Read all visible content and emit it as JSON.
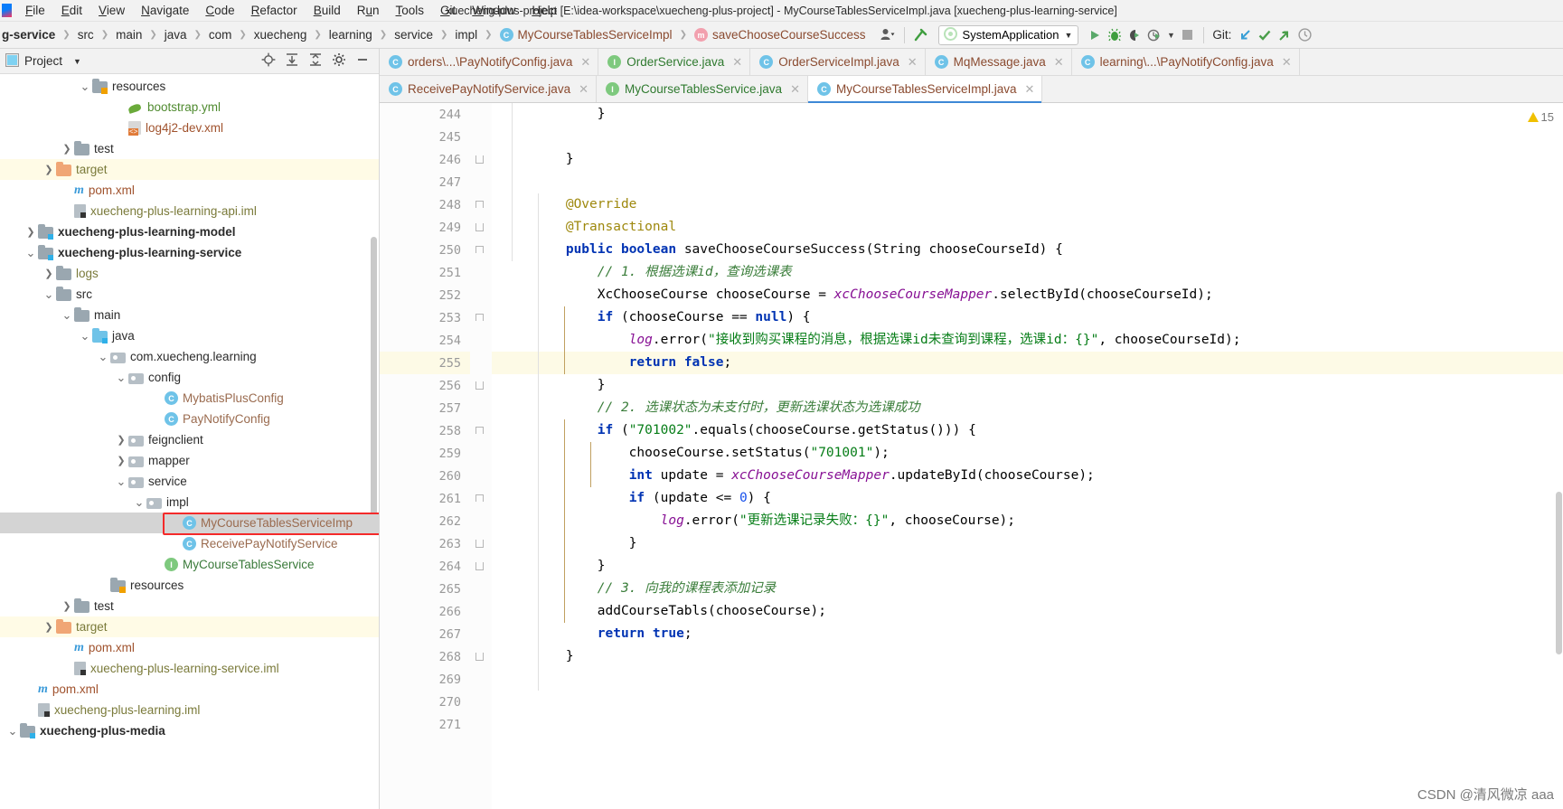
{
  "window": {
    "title": "xuecheng-plus-project [E:\\idea-workspace\\xuecheng-plus-project] - MyCourseTablesServiceImpl.java [xuecheng-plus-learning-service]"
  },
  "menu": {
    "items": [
      {
        "label": "File",
        "mnemonic": "F"
      },
      {
        "label": "Edit",
        "mnemonic": "E"
      },
      {
        "label": "View",
        "mnemonic": "V"
      },
      {
        "label": "Navigate",
        "mnemonic": "N"
      },
      {
        "label": "Code",
        "mnemonic": "C"
      },
      {
        "label": "Refactor",
        "mnemonic": "R"
      },
      {
        "label": "Build",
        "mnemonic": "B"
      },
      {
        "label": "Run",
        "mnemonic": "u"
      },
      {
        "label": "Tools",
        "mnemonic": "T"
      },
      {
        "label": "Git",
        "mnemonic": "G"
      },
      {
        "label": "Window",
        "mnemonic": "W"
      },
      {
        "label": "Help",
        "mnemonic": "H"
      }
    ]
  },
  "navbar": {
    "crumbs": [
      {
        "label": "g-service",
        "kind": "module"
      },
      {
        "label": "src",
        "kind": "dir"
      },
      {
        "label": "main",
        "kind": "dir"
      },
      {
        "label": "java",
        "kind": "dir"
      },
      {
        "label": "com",
        "kind": "pkg"
      },
      {
        "label": "xuecheng",
        "kind": "pkg"
      },
      {
        "label": "learning",
        "kind": "pkg"
      },
      {
        "label": "service",
        "kind": "pkg"
      },
      {
        "label": "impl",
        "kind": "pkg"
      },
      {
        "label": "MyCourseTablesServiceImpl",
        "kind": "class",
        "badge": "C"
      },
      {
        "label": "saveChooseCourseSuccess",
        "kind": "method",
        "badge": "m"
      }
    ],
    "run_config": "SystemApplication",
    "git_label": "Git:",
    "icons": [
      "user-settings-icon",
      "build-hammer-icon",
      "run-icon",
      "debug-icon",
      "run-with-coverage-icon",
      "profiler-icon",
      "dropdown-arrow-icon",
      "stop-icon",
      "git-update-icon",
      "git-commit-icon",
      "git-push-icon",
      "git-history-icon"
    ]
  },
  "project_panel": {
    "title": "Project",
    "header_icons": [
      "locate-icon",
      "expand-all-icon",
      "collapse-all-icon",
      "gear-icon",
      "hide-icon"
    ],
    "tree": [
      {
        "indent": 5,
        "twist": "v",
        "icon": "folder-resources",
        "label": "resources",
        "style": "plain"
      },
      {
        "indent": 7,
        "twist": "",
        "icon": "yml",
        "label": "bootstrap.yml",
        "style": "ymlgreen"
      },
      {
        "indent": 7,
        "twist": "",
        "icon": "xml",
        "label": "log4j2-dev.xml",
        "style": "xmlred"
      },
      {
        "indent": 4,
        "twist": ">",
        "icon": "folder",
        "label": "test",
        "style": "plain"
      },
      {
        "indent": 3,
        "twist": ">",
        "icon": "folder-orange",
        "label": "target",
        "style": "olive",
        "row": "hl-yellow"
      },
      {
        "indent": 4,
        "twist": "",
        "icon": "maven",
        "label": "pom.xml",
        "style": "xmlred"
      },
      {
        "indent": 4,
        "twist": "",
        "icon": "file",
        "label": "xuecheng-plus-learning-api.iml",
        "style": "olive"
      },
      {
        "indent": 2,
        "twist": ">",
        "icon": "folder-module",
        "label": "xuecheng-plus-learning-model",
        "style": "bold"
      },
      {
        "indent": 2,
        "twist": "v",
        "icon": "folder-module",
        "label": "xuecheng-plus-learning-service",
        "style": "bold"
      },
      {
        "indent": 3,
        "twist": ">",
        "icon": "folder",
        "label": "logs",
        "style": "olive"
      },
      {
        "indent": 3,
        "twist": "v",
        "icon": "folder",
        "label": "src",
        "style": "plain"
      },
      {
        "indent": 4,
        "twist": "v",
        "icon": "folder",
        "label": "main",
        "style": "plain"
      },
      {
        "indent": 5,
        "twist": "v",
        "icon": "folder-blue",
        "label": "java",
        "style": "plain"
      },
      {
        "indent": 6,
        "twist": "v",
        "icon": "package",
        "label": "com.xuecheng.learning",
        "style": "plain"
      },
      {
        "indent": 7,
        "twist": "v",
        "icon": "package",
        "label": "config",
        "style": "plain"
      },
      {
        "indent": 9,
        "twist": "",
        "icon": "class",
        "label": "MybatisPlusConfig",
        "style": "brown"
      },
      {
        "indent": 9,
        "twist": "",
        "icon": "class",
        "label": "PayNotifyConfig",
        "style": "brown"
      },
      {
        "indent": 7,
        "twist": ">",
        "icon": "package",
        "label": "feignclient",
        "style": "plain"
      },
      {
        "indent": 7,
        "twist": ">",
        "icon": "package",
        "label": "mapper",
        "style": "plain"
      },
      {
        "indent": 7,
        "twist": "v",
        "icon": "package",
        "label": "service",
        "style": "plain"
      },
      {
        "indent": 8,
        "twist": "v",
        "icon": "package",
        "label": "impl",
        "style": "plain"
      },
      {
        "indent": 10,
        "twist": "",
        "icon": "class",
        "label": "MyCourseTablesServiceImp",
        "style": "brown",
        "row": "hl-grey",
        "boxed": true
      },
      {
        "indent": 10,
        "twist": "",
        "icon": "class",
        "label": "ReceivePayNotifyService",
        "style": "brown"
      },
      {
        "indent": 9,
        "twist": "",
        "icon": "interface",
        "label": "MyCourseTablesService",
        "style": "green"
      },
      {
        "indent": 6,
        "twist": "",
        "icon": "folder-resources",
        "label": "resources",
        "style": "plain"
      },
      {
        "indent": 4,
        "twist": ">",
        "icon": "folder",
        "label": "test",
        "style": "plain"
      },
      {
        "indent": 3,
        "twist": ">",
        "icon": "folder-orange",
        "label": "target",
        "style": "olive",
        "row": "hl-yellow"
      },
      {
        "indent": 4,
        "twist": "",
        "icon": "maven",
        "label": "pom.xml",
        "style": "xmlred"
      },
      {
        "indent": 4,
        "twist": "",
        "icon": "file",
        "label": "xuecheng-plus-learning-service.iml",
        "style": "olive"
      },
      {
        "indent": 2,
        "twist": "",
        "icon": "maven",
        "label": "pom.xml",
        "style": "xmlred"
      },
      {
        "indent": 2,
        "twist": "",
        "icon": "file",
        "label": "xuecheng-plus-learning.iml",
        "style": "olive"
      },
      {
        "indent": 1,
        "twist": "v",
        "icon": "folder-module",
        "label": "xuecheng-plus-media",
        "style": "bold"
      }
    ]
  },
  "editor": {
    "tabs_row1": [
      {
        "label": "orders\\...\\PayNotifyConfig.java",
        "badge": "C",
        "active": false
      },
      {
        "label": "OrderService.java",
        "badge": "I",
        "active": false
      },
      {
        "label": "OrderServiceImpl.java",
        "badge": "C",
        "active": false
      },
      {
        "label": "MqMessage.java",
        "badge": "C",
        "active": false
      },
      {
        "label": "learning\\...\\PayNotifyConfig.java",
        "badge": "C",
        "active": false
      }
    ],
    "tabs_row2": [
      {
        "label": "ReceivePayNotifyService.java",
        "badge": "C",
        "active": false
      },
      {
        "label": "MyCourseTablesService.java",
        "badge": "I",
        "active": false
      },
      {
        "label": "MyCourseTablesServiceImpl.java",
        "badge": "C",
        "active": true
      }
    ],
    "warning_count": "15",
    "first_line_number": 244,
    "lines": [
      {
        "n": 244,
        "html": "            <span class=\"brace\">}</span>",
        "fold": "",
        "hl": false
      },
      {
        "n": 245,
        "html": "",
        "fold": "",
        "hl": false
      },
      {
        "n": 246,
        "html": "        <span class=\"brace\">}</span>",
        "fold": "top-end",
        "hl": false
      },
      {
        "n": 247,
        "html": "",
        "fold": "",
        "hl": false
      },
      {
        "n": 248,
        "html": "        <span class=\"ann\">@Override</span>",
        "fold": "top",
        "hl": false
      },
      {
        "n": 249,
        "html": "        <span class=\"ann\">@Transactional</span>",
        "fold": "end",
        "hl": false
      },
      {
        "n": 250,
        "html": "        <span class=\"kw\">public</span> <span class=\"kw\">boolean</span> <span class=\"plain\">saveChooseCourseSuccess</span>(<span class=\"plain\">String</span> chooseCourseId) <span class=\"brace\">{</span>",
        "fold": "top",
        "hl": false,
        "marker": true
      },
      {
        "n": 251,
        "html": "            <span class=\"cmtG\">// 1. 根据选课id，查询选课表</span>",
        "fold": "",
        "hl": false
      },
      {
        "n": 252,
        "html": "            XcChooseCourse chooseCourse <span class=\"plain\">=</span> <span class=\"fld\">xcChooseCourseMapper</span>.selectById(chooseCourseId);",
        "fold": "",
        "hl": false
      },
      {
        "n": 253,
        "html": "            <span class=\"kw\">if</span> (chooseCourse <span class=\"plain\">==</span> <span class=\"kw\">null</span>) <span class=\"brace\">{</span>",
        "fold": "top",
        "hl": false
      },
      {
        "n": 254,
        "html": "                <span class=\"fld\">log</span>.error(<span class=\"str\">\"接收到购买课程的消息，根据选课id未查询到课程，选课id：{}\"</span>, chooseCourseId);",
        "fold": "",
        "hl": false
      },
      {
        "n": 255,
        "html": "                <span class=\"kw\">return</span> <span class=\"kw\">false</span>;",
        "fold": "",
        "hl": true
      },
      {
        "n": 256,
        "html": "            <span class=\"brace\">}</span>",
        "fold": "end",
        "hl": false
      },
      {
        "n": 257,
        "html": "            <span class=\"cmtG\">// 2. 选课状态为未支付时，更新选课状态为选课成功</span>",
        "fold": "",
        "hl": false
      },
      {
        "n": 258,
        "html": "            <span class=\"kw\">if</span> (<span class=\"str\">\"701002\"</span>.equals(chooseCourse.getStatus())) <span class=\"brace\">{</span>",
        "fold": "top",
        "hl": false
      },
      {
        "n": 259,
        "html": "                chooseCourse.setStatus(<span class=\"str\">\"701001\"</span>);",
        "fold": "",
        "hl": false
      },
      {
        "n": 260,
        "html": "                <span class=\"kw\">int</span> update <span class=\"plain\">=</span> <span class=\"fld\">xcChooseCourseMapper</span>.updateById(chooseCourse);",
        "fold": "",
        "hl": false
      },
      {
        "n": 261,
        "html": "                <span class=\"kw\">if</span> (update <span class=\"plain\">&lt;=</span> <span class=\"num\">0</span>) <span class=\"brace\">{</span>",
        "fold": "top",
        "hl": false
      },
      {
        "n": 262,
        "html": "                    <span class=\"fld\">log</span>.error(<span class=\"str\">\"更新选课记录失败：{}\"</span>, chooseCourse);",
        "fold": "",
        "hl": false
      },
      {
        "n": 263,
        "html": "                <span class=\"brace\">}</span>",
        "fold": "end",
        "hl": false
      },
      {
        "n": 264,
        "html": "            <span class=\"brace\">}</span>",
        "fold": "end",
        "hl": false
      },
      {
        "n": 265,
        "html": "            <span class=\"cmtG\">// 3. 向我的课程表添加记录</span>",
        "fold": "",
        "hl": false
      },
      {
        "n": 266,
        "html": "            addCourseTabls(chooseCourse);",
        "fold": "",
        "hl": false
      },
      {
        "n": 267,
        "html": "            <span class=\"kw\">return</span> <span class=\"kw\">true</span>;",
        "fold": "",
        "hl": false
      },
      {
        "n": 268,
        "html": "        <span class=\"brace\">}</span>",
        "fold": "end",
        "hl": false
      },
      {
        "n": 269,
        "html": "",
        "fold": "",
        "hl": false
      },
      {
        "n": 270,
        "html": "",
        "fold": "",
        "hl": false
      },
      {
        "n": 271,
        "html": "",
        "fold": "",
        "hl": false
      }
    ]
  },
  "watermark": "CSDN @清风微凉 aaa",
  "colors": {
    "accent_blue": "#3e88d6",
    "highlight_yellow": "#fffbe6",
    "selection_grey": "#d4d4d4",
    "red_box": "#f42a2a",
    "warning_yellow": "#f0c000",
    "keyword_blue": "#0033b3",
    "string_green": "#067d17",
    "annotation_gold": "#9e880d",
    "field_purple": "#871094",
    "comment_green": "#3a7d3a"
  }
}
